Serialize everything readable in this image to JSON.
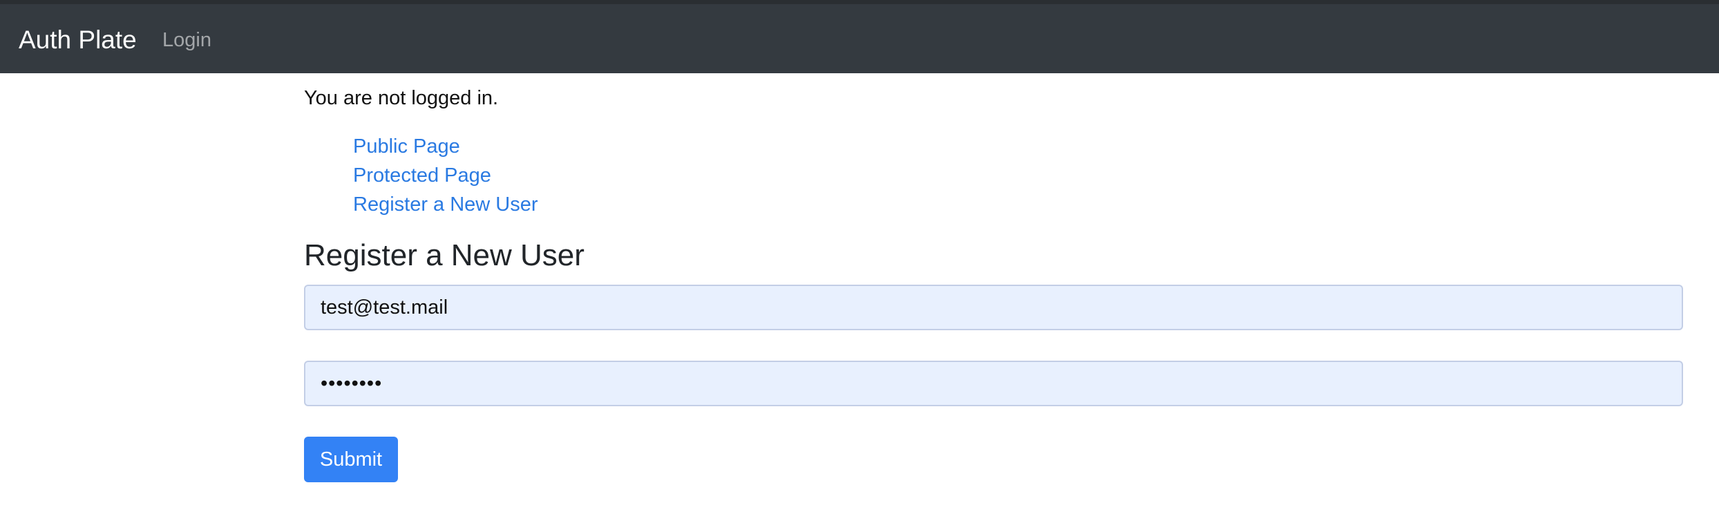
{
  "navbar": {
    "brand": "Auth Plate",
    "login_link": "Login"
  },
  "main": {
    "status_text": "You are not logged in.",
    "links": [
      {
        "label": "Public Page"
      },
      {
        "label": "Protected Page"
      },
      {
        "label": "Register a New User"
      }
    ],
    "form": {
      "title": "Register a New User",
      "email_value": "test@test.mail",
      "password_value": "testtest",
      "submit_label": "Submit"
    }
  },
  "colors": {
    "navbar_bg": "#343a40",
    "link": "#2a7ae2",
    "input_autofill_bg": "#e8f0fe",
    "primary_button": "#3382f5"
  }
}
